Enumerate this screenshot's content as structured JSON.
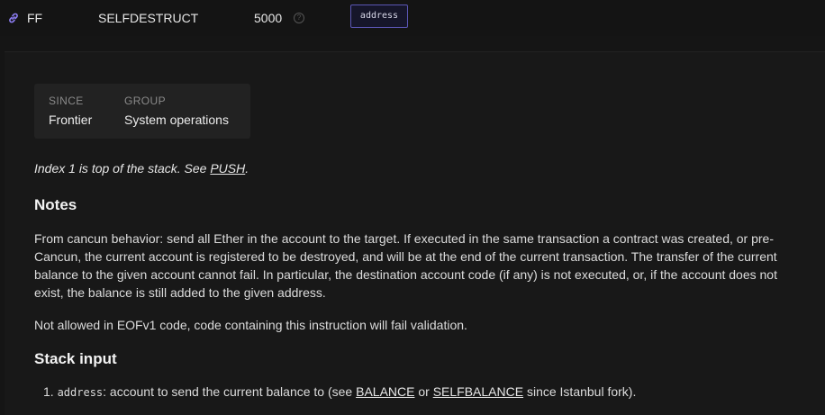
{
  "row": {
    "opcode": "FF",
    "name": "SELFDESTRUCT",
    "gas": "5000",
    "help": "?",
    "input": "address"
  },
  "info": {
    "since_label": "Since",
    "since_value": "Frontier",
    "group_label": "Group",
    "group_value": "System operations"
  },
  "stack_note": {
    "prefix": "Index 1 is top of the stack. See ",
    "link": "PUSH",
    "suffix": "."
  },
  "notes": {
    "heading": "Notes",
    "paragraph1": "From cancun behavior: send all Ether in the account to the target. If executed in the same transaction a contract was created, or pre-Cancun, the current account is registered to be destroyed, and will be at the end of the current transaction. The transfer of the current balance to the given account cannot fail. In particular, the destination account code (if any) is not executed, or, if the account does not exist, the balance is still added to the given address.",
    "paragraph2": "Not allowed in EOFv1 code, code containing this instruction will fail validation."
  },
  "stack_input": {
    "heading": "Stack input",
    "item_number": "1.",
    "item_param": "address",
    "item_text": ": account to send the current balance to (see ",
    "link1": "BALANCE",
    "between": " or ",
    "link2": "SELFBALANCE",
    "suffix": " since Istanbul fork)."
  }
}
